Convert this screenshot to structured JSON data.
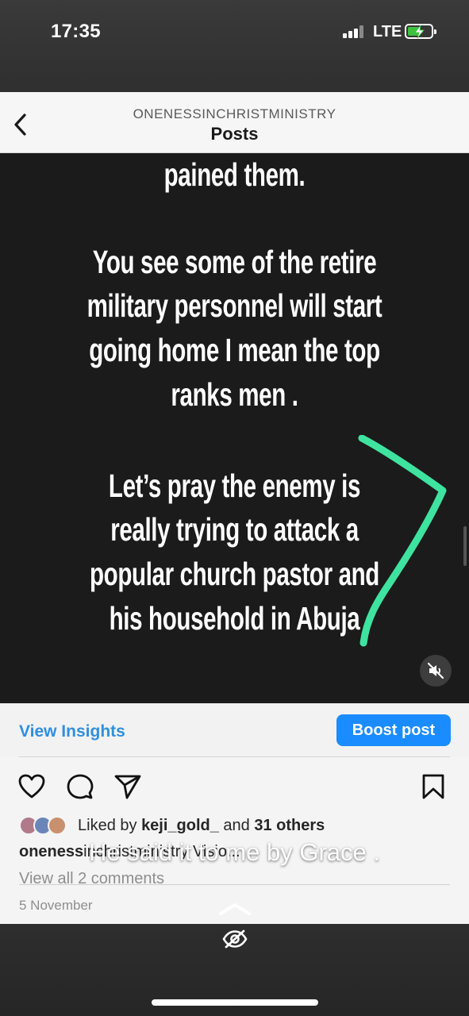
{
  "status_bar": {
    "time": "17:35",
    "network": "LTE"
  },
  "header": {
    "account": "ONENESSINCHRISTMINISTRY",
    "title": "Posts"
  },
  "post": {
    "image_lines": [
      "pained them.",
      "You see some of the retire",
      "military personnel will start",
      "going home I mean the top",
      "ranks men  .",
      "Let’s pray the enemy is",
      "really trying to attack a",
      "popular church pastor and",
      "his household  in Abuja"
    ],
    "checkmark_color": "#3fe3a0"
  },
  "insights": {
    "view_insights": "View Insights",
    "boost_post": "Boost post"
  },
  "likes": {
    "prefix": "Liked by ",
    "user": "keji_gold_",
    "middle": " and ",
    "others": "31 others"
  },
  "caption": {
    "username": "oneness",
    "text": "inchristministry Visio..."
  },
  "comments_link": "View all 2 comments",
  "date": "5 November",
  "story_caption": "He said it to me by Grace .",
  "colors": {
    "accent": "#1a8cff",
    "link": "#2f8fe0"
  }
}
